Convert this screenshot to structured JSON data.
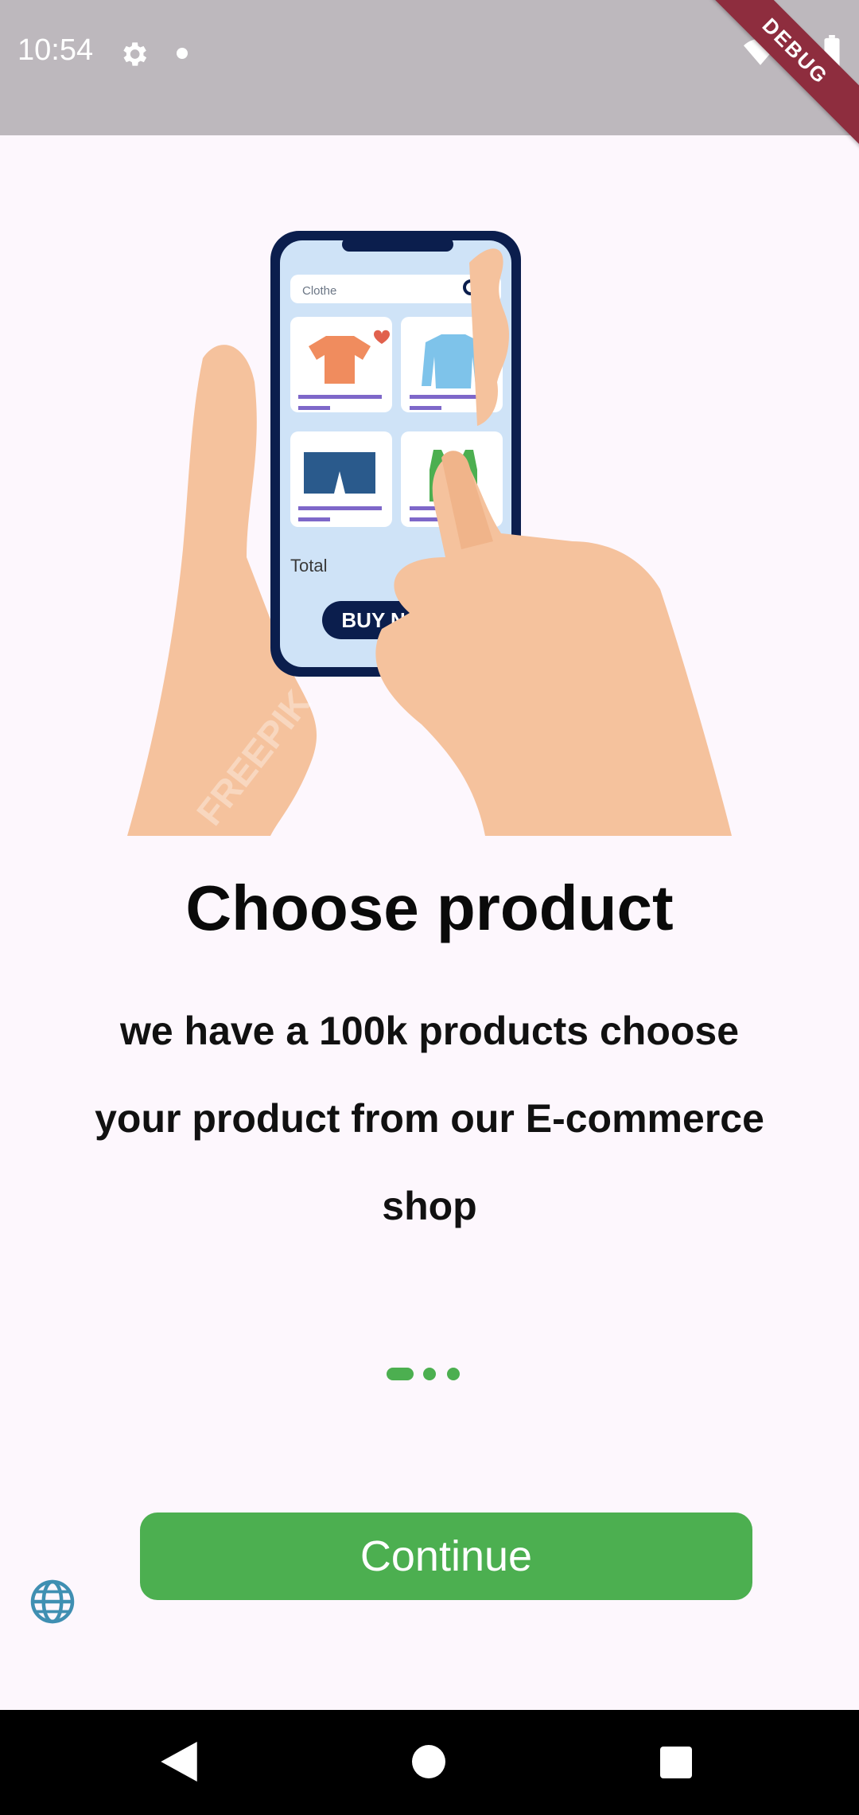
{
  "status_bar": {
    "time": "10:54",
    "debug_label": "DEBUG"
  },
  "hero_illustration": {
    "search_text": "Clothe",
    "total_label": "Total",
    "total_value": "$ ...",
    "buy_label": "BUY NOW",
    "watermark": "FREEPIK"
  },
  "onboarding": {
    "title": "Choose product",
    "description": "we have a 100k products choose your product from our E-commerce shop",
    "page_indicator": {
      "pages": 3,
      "active": 1
    },
    "continue_label": "Continue"
  },
  "colors": {
    "accent": "#4caf50",
    "status_bar": "#bdb8bd",
    "background": "#fdf7fd",
    "globe_icon": "#3f8fb2"
  },
  "icons": [
    "gear-icon",
    "wifi-icon",
    "signal-icon",
    "battery-icon",
    "globe-icon",
    "back-icon",
    "home-icon",
    "recent-apps-icon"
  ]
}
